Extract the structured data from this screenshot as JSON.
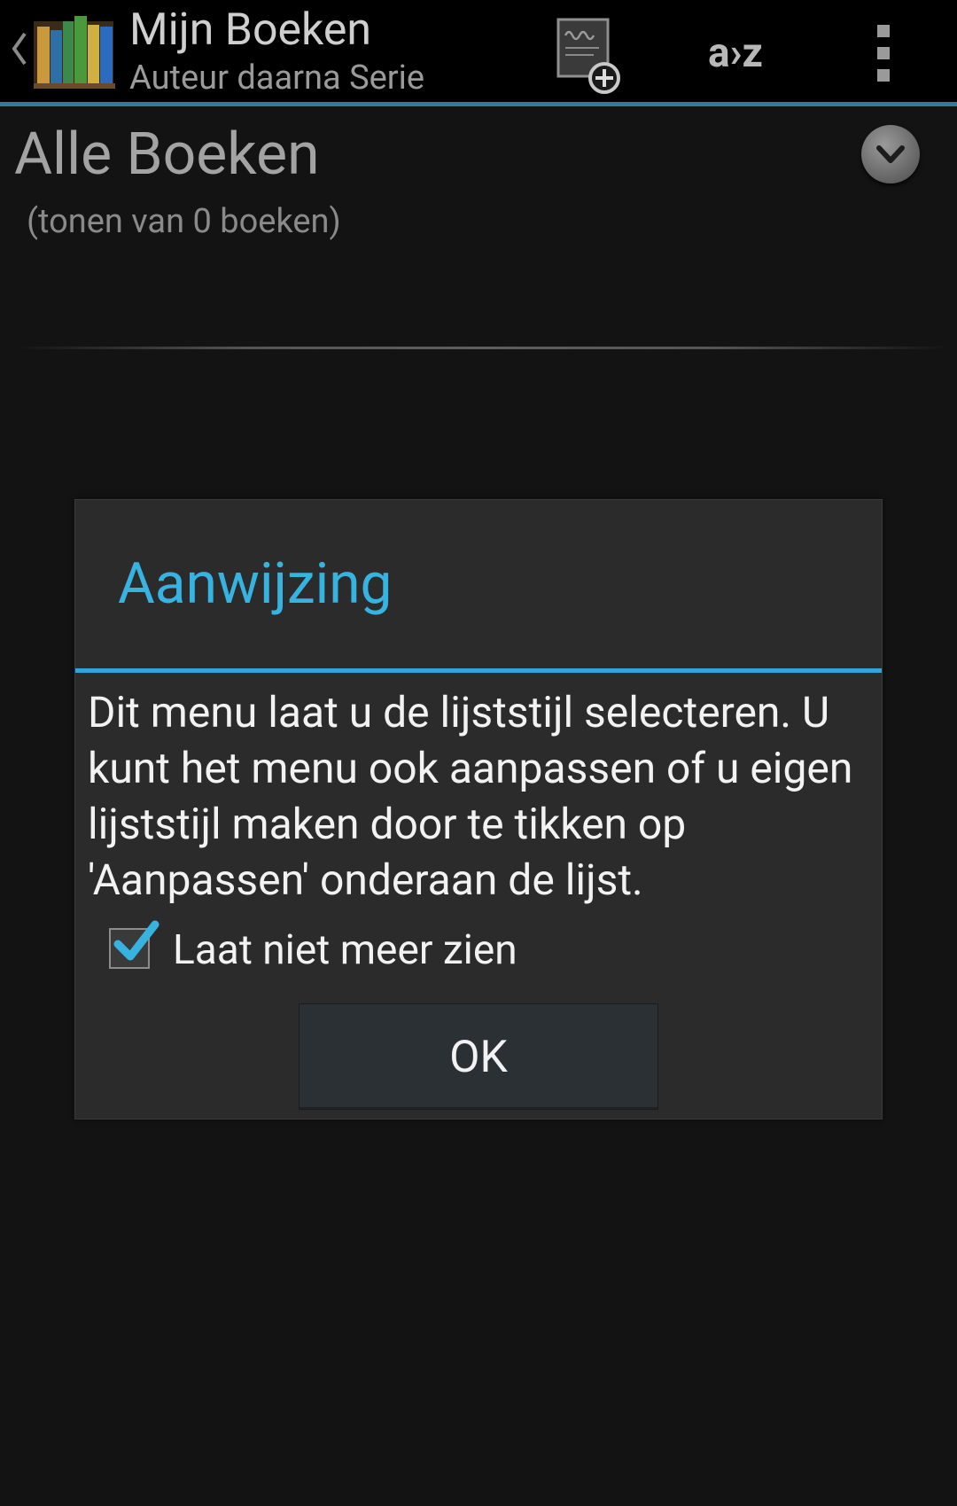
{
  "action_bar": {
    "title": "Mijn Boeken",
    "subtitle": "Auteur daarna Serie",
    "sort_label": "a›z",
    "up_caret": "‹",
    "icons": {
      "up": "chevron-left-icon",
      "app": "books-icon",
      "add": "add-book-icon",
      "overflow": "more-vert-icon"
    }
  },
  "list_header": {
    "title": "Alle Boeken",
    "count_text": "(tonen van 0 boeken)",
    "dropdown_icon": "chevron-down-icon"
  },
  "dialog": {
    "title": "Aanwijzing",
    "message": "Dit menu laat u de lijststijl selecteren. U kunt het menu ook aanpassen of u eigen lijststijl maken door te tikken op 'Aanpassen' onderaan de lijst.",
    "checkbox_label": "Laat niet meer zien",
    "checkbox_checked": true,
    "ok_label": "OK"
  },
  "colors": {
    "background": "#131313",
    "action_bar": "#000000",
    "accent": "#37b3e2",
    "dialog_bg": "#2b2b2b"
  }
}
